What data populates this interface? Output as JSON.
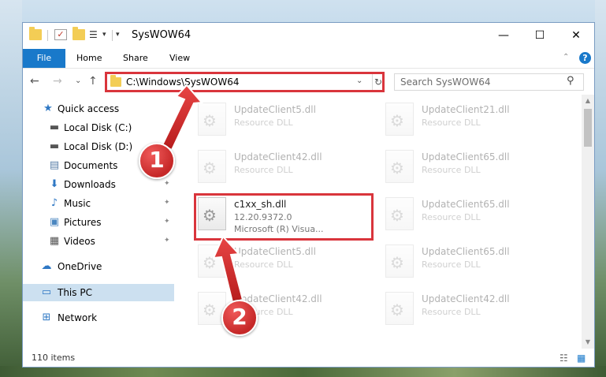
{
  "window": {
    "title": "SysWOW64",
    "minimize_glyph": "—",
    "maximize_glyph": "☐",
    "close_glyph": "✕"
  },
  "ribbon": {
    "file_tab": "File",
    "tabs": [
      "Home",
      "Share",
      "View"
    ],
    "help_glyph": "?"
  },
  "navigation": {
    "back_glyph": "←",
    "forward_glyph": "→",
    "recent_glyph": "⌄",
    "up_glyph": "↑",
    "address_path": "C:\\Windows\\SysWOW64",
    "refresh_glyph": "↻",
    "search_placeholder": "Search SysWOW64"
  },
  "sidebar": {
    "items": [
      {
        "label": "Quick access",
        "icon": "star-icon",
        "glyph": "★",
        "color": "#2f78c4",
        "pinned": false
      },
      {
        "label": "Local Disk (C:)",
        "icon": "drive-icon",
        "glyph": "▬",
        "color": "#555555",
        "pinned": false
      },
      {
        "label": "Local Disk (D:)",
        "icon": "drive-icon",
        "glyph": "▬",
        "color": "#555555",
        "pinned": false
      },
      {
        "label": "Documents",
        "icon": "documents-icon",
        "glyph": "▤",
        "color": "#5a7fa8",
        "pinned": true
      },
      {
        "label": "Downloads",
        "icon": "download-icon",
        "glyph": "⬇",
        "color": "#2f78c4",
        "pinned": true
      },
      {
        "label": "Music",
        "icon": "music-icon",
        "glyph": "♪",
        "color": "#2f78c4",
        "pinned": true
      },
      {
        "label": "Pictures",
        "icon": "pictures-icon",
        "glyph": "▣",
        "color": "#4a86c0",
        "pinned": true
      },
      {
        "label": "Videos",
        "icon": "videos-icon",
        "glyph": "▦",
        "color": "#555555",
        "pinned": true
      },
      {
        "label": "OneDrive",
        "icon": "cloud-icon",
        "glyph": "☁",
        "color": "#2f78c4",
        "pinned": false
      },
      {
        "label": "This PC",
        "icon": "computer-icon",
        "glyph": "▭",
        "color": "#2f78c4",
        "pinned": false
      },
      {
        "label": "Network",
        "icon": "network-icon",
        "glyph": "⊞",
        "color": "#2f78c4",
        "pinned": false
      }
    ],
    "pin_glyph": "📌"
  },
  "files": {
    "left_column": [
      {
        "name": "UpdateClient5.dll",
        "desc": "Resource DLL",
        "faded": true
      },
      {
        "name": "UpdateClient42.dll",
        "desc": "Resource DLL",
        "faded": true
      },
      {
        "name": "c1xx_sh.dll",
        "desc": "12.20.9372.0",
        "desc2": "Microsoft (R) Visua...",
        "faded": false
      },
      {
        "name": "UpdateClient5.dll",
        "desc": "Resource DLL",
        "faded": true
      },
      {
        "name": "UpdateClient42.dll",
        "desc": "Resource DLL",
        "faded": true
      }
    ],
    "right_column": [
      {
        "name": "UpdateClient21.dll",
        "desc": "Resource DLL",
        "faded": true
      },
      {
        "name": "UpdateClient65.dll",
        "desc": "Resource DLL",
        "faded": true
      },
      {
        "name": "UpdateClient65.dll",
        "desc": "Resource DLL",
        "faded": true
      },
      {
        "name": "UpdateClient65.dll",
        "desc": "Resource DLL",
        "faded": true
      },
      {
        "name": "UpdateClient42.dll",
        "desc": "Resource DLL",
        "faded": true
      }
    ]
  },
  "status": {
    "item_count": "110 items"
  },
  "callouts": [
    {
      "number": "1"
    },
    {
      "number": "2"
    }
  ],
  "colors": {
    "accent": "#1979ca",
    "highlight": "#d9353c",
    "selected_bg": "#cce0f0"
  }
}
